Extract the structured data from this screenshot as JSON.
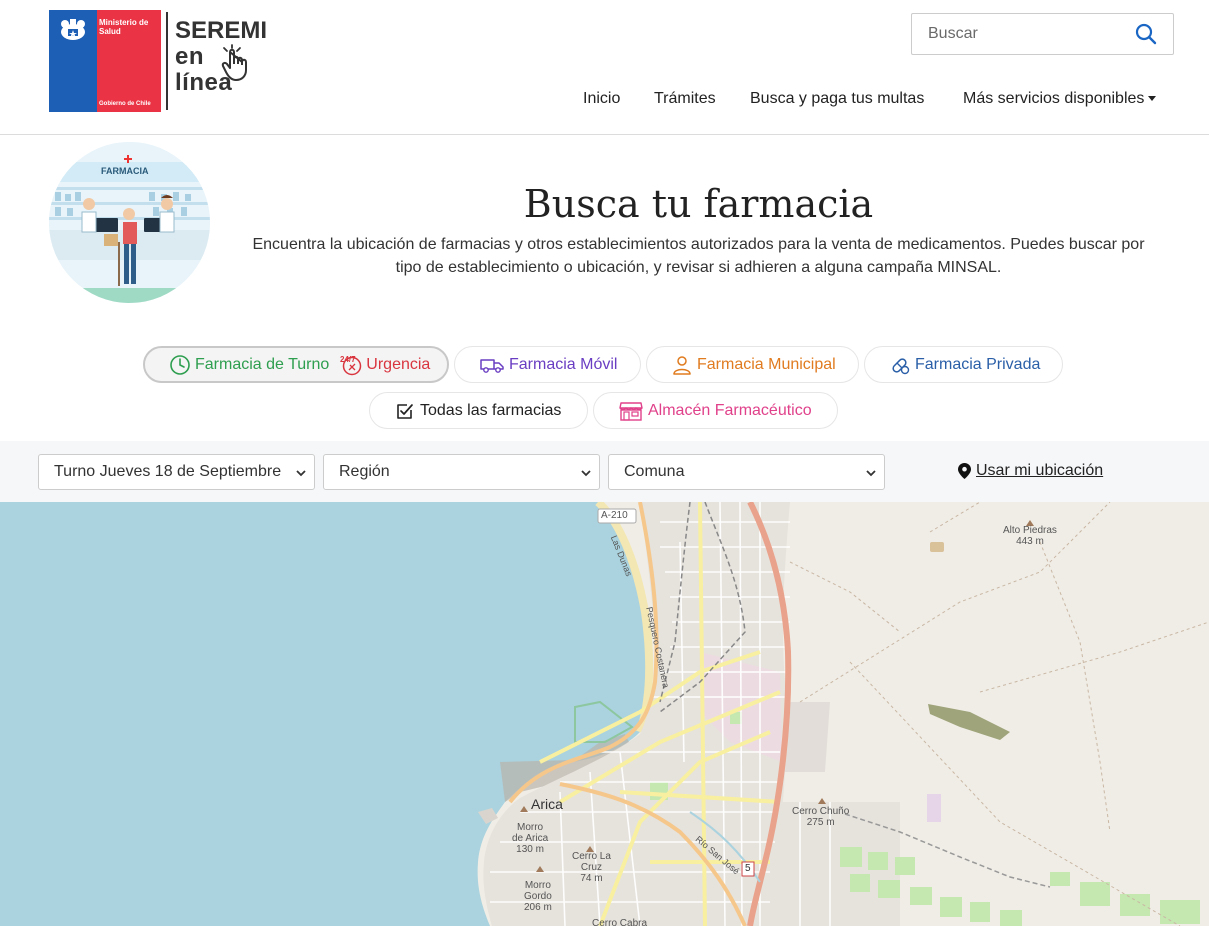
{
  "header": {
    "logo_line1": "Ministerio de Salud",
    "logo_line2": "Gobierno de Chile",
    "brand_1": "SEREMI",
    "brand_2": "en",
    "brand_3": "línea",
    "search_placeholder": "Buscar",
    "nav": [
      {
        "label": "Inicio"
      },
      {
        "label": "Trámites"
      },
      {
        "label": "Busca y paga tus multas"
      },
      {
        "label": "Más servicios disponibles"
      }
    ]
  },
  "hero": {
    "image_label": "FARMACIA",
    "title": "Busca tu farmacia",
    "description": "Encuentra la ubicación de farmacias y otros establecimientos autorizados para la venta de medicamentos. Puedes buscar por tipo de establecimiento o ubicación, y revisar si adhieren a alguna campaña MINSAL."
  },
  "filters": {
    "turno": "Farmacia de Turno",
    "urgencia": "Urgencia",
    "movil": "Farmacia Móvil",
    "municipal": "Farmacia Municipal",
    "privada": "Farmacia Privada",
    "todas": "Todas las farmacias",
    "almacen": "Almacén Farmacéutico",
    "urgencia_badge": "24/7"
  },
  "colors": {
    "turno": "#2e9e4f",
    "urgencia": "#d9353f",
    "movil": "#6a3ec2",
    "municipal": "#e07b1f",
    "privada": "#2a5fa8",
    "almacen": "#e0418a"
  },
  "selects": {
    "turno": "Turno Jueves 18 de Septiembre",
    "region": "Región",
    "comuna": "Comuna",
    "use_location": "Usar mi ubicación"
  },
  "map": {
    "labels": {
      "a210": "A-210",
      "las_dunas": "Las Dunas",
      "alto_piedras": "Alto Piedras",
      "alto_piedras_alt": "443 m",
      "arica": "Arica",
      "morro": "Morro",
      "de_arica": "de Arica",
      "morro_alt": "130 m",
      "cerro_la_cruz": "Cerro La",
      "cruz": "Cruz",
      "cruz_alt": "74 m",
      "morro_gordo": "Morro",
      "gordo": "Gordo",
      "gordo_alt": "206 m",
      "cerro_chuno": "Cerro Chuño",
      "chuno_alt": "275 m",
      "rio_san_jose": "Río San José",
      "route5": "5",
      "costanera": "Pesquero Costanera",
      "cerro_cabra": "Cerro Cabra"
    }
  }
}
